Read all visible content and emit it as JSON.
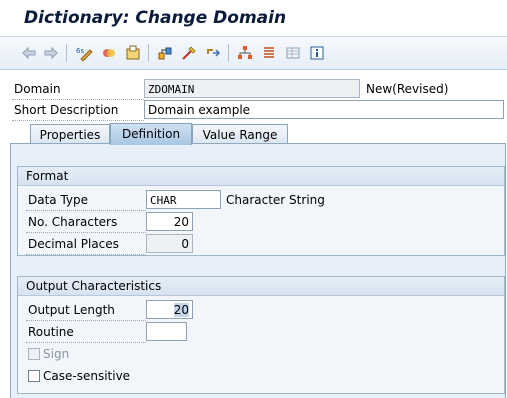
{
  "window": {
    "title": "Dictionary: Change Domain"
  },
  "toolbar": {
    "buttons": [
      {
        "icon": "back-arrow-icon"
      },
      {
        "icon": "forward-arrow-icon"
      },
      {
        "icon": "display-change-toggle-icon"
      },
      {
        "icon": "other-object-icon"
      },
      {
        "icon": "activate-icon"
      },
      {
        "icon": "check-icon"
      },
      {
        "icon": "where-used-icon"
      },
      {
        "icon": "move-icon"
      },
      {
        "icon": "hierarchy-icon"
      },
      {
        "icon": "documentation-icon"
      },
      {
        "icon": "table-icon"
      },
      {
        "icon": "info-icon"
      }
    ]
  },
  "header": {
    "domain_label": "Domain",
    "domain_value": "ZDOMAIN",
    "status": "New(Revised)",
    "short_desc_label": "Short Description",
    "short_desc_value": "Domain example"
  },
  "tabs": [
    {
      "label": "Properties",
      "active": false
    },
    {
      "label": "Definition",
      "active": true
    },
    {
      "label": "Value Range",
      "active": false
    }
  ],
  "format": {
    "title": "Format",
    "data_type_label": "Data Type",
    "data_type_value": "CHAR",
    "data_type_desc": "Character String",
    "no_chars_label": "No. Characters",
    "no_chars_value": "20",
    "decimal_places_label": "Decimal Places",
    "decimal_places_value": "0"
  },
  "output": {
    "title": "Output Characteristics",
    "output_length_label": "Output Length",
    "output_length_value": "20",
    "routine_label": "Routine",
    "routine_value": "",
    "sign_label": "Sign",
    "sign_checked": false,
    "case_label": "Case-sensitive",
    "case_checked": false
  }
}
